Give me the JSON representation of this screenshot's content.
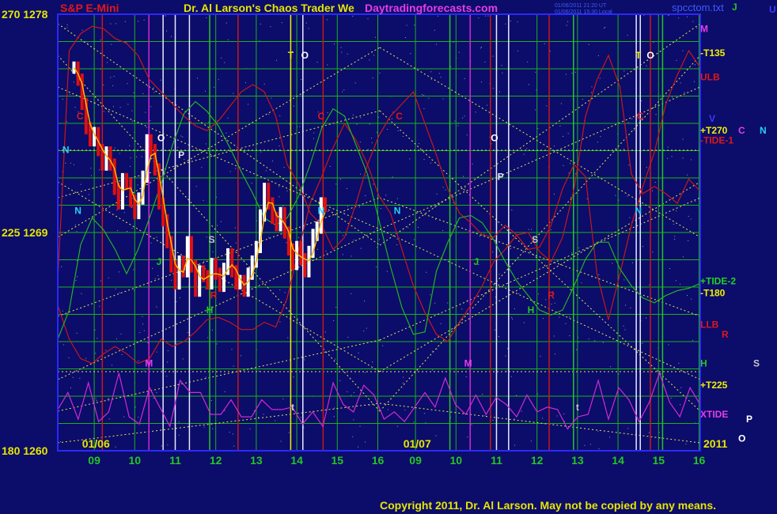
{
  "header": {
    "symbol": "S&P E-Mini",
    "title": "Dr. Al Larson's Chaos Trader We",
    "site": "Daytradingforecasts.com",
    "stamp1": "01/06/2011 21:20 UT",
    "stamp2": "01/06/2011 15:30 Local",
    "file": "spcctom.txt"
  },
  "footer": {
    "copyright": "Copyright 2011, Dr. Al Larson. May not be copied by any means.",
    "year": "2011"
  },
  "colors": {
    "background": "#0c0c6a",
    "frame": "#2a2aff",
    "grid": "#18b418",
    "fan": "#e6e650",
    "tick_label": "#e6e600",
    "up_bar": "#ffffff",
    "down_bar": "#e01010",
    "moving_avg": "#ffb400",
    "red_line": "#c81818",
    "green_line": "#22b422",
    "xtide": "#d22ad2",
    "blue_line": "#3c3cff"
  },
  "chart_data": {
    "type": "line",
    "title": "S&P E-Mini",
    "xlabel": "",
    "ylabel": "",
    "ylim": [
      1260,
      1278
    ],
    "grid": true,
    "y_labels_left": [
      {
        "value": 1278,
        "text": "270  1278"
      },
      {
        "value": 1269,
        "text": "225  1269"
      },
      {
        "value": 1260,
        "text": "180  1260"
      }
    ],
    "x_ticks": [
      {
        "day": 1,
        "hour": 9,
        "label": "09"
      },
      {
        "day": 1,
        "hour": 10,
        "label": "10"
      },
      {
        "day": 1,
        "hour": 11,
        "label": "11"
      },
      {
        "day": 1,
        "hour": 12,
        "label": "12"
      },
      {
        "day": 1,
        "hour": 13,
        "label": "13"
      },
      {
        "day": 1,
        "hour": 14,
        "label": "14"
      },
      {
        "day": 1,
        "hour": 15,
        "label": "15"
      },
      {
        "day": 1,
        "hour": 16,
        "label": "16"
      },
      {
        "day": 2,
        "hour": 9,
        "label": "09"
      },
      {
        "day": 2,
        "hour": 10,
        "label": "10"
      },
      {
        "day": 2,
        "hour": 11,
        "label": "11"
      },
      {
        "day": 2,
        "hour": 12,
        "label": "12"
      },
      {
        "day": 2,
        "hour": 13,
        "label": "13"
      },
      {
        "day": 2,
        "hour": 14,
        "label": "14"
      },
      {
        "day": 2,
        "hour": 15,
        "label": "15"
      },
      {
        "day": 2,
        "hour": 16,
        "label": "16"
      }
    ],
    "date_labels": [
      {
        "day": 1,
        "hour": 8.7,
        "label": "01/06"
      },
      {
        "day": 2,
        "hour": 8.7,
        "label": "01/07"
      }
    ],
    "price_bars": {
      "interval_hours": 0.1,
      "start_hour": 8.5,
      "values": [
        1275.8,
        1275.3,
        1274.3,
        1273.3,
        1272.8,
        1273.1,
        1272.4,
        1271.8,
        1272.3,
        1271.8,
        1270.8,
        1270.2,
        1271.2,
        1271.0,
        1270.3,
        1269.8,
        1270.4,
        1271.3,
        1272.8,
        1272.4,
        1271.6,
        1270.2,
        1269.5,
        1268.6,
        1267.6,
        1266.9,
        1267.8,
        1267.4,
        1268.6,
        1267.6,
        1266.6,
        1267.4,
        1267.2,
        1266.9,
        1267.7,
        1267.3,
        1266.8,
        1267.5,
        1268.1,
        1267.4,
        1266.9,
        1267.0,
        1266.6,
        1267.3,
        1267.8,
        1268.4,
        1269.7,
        1270.8,
        1270.2,
        1269.6,
        1269.3,
        1269.8,
        1269.0,
        1268.3,
        1267.7,
        1268.4,
        1267.9,
        1267.4,
        1268.2,
        1268.9,
        1269.2,
        1270.2,
        1270.1
      ]
    },
    "series": [
      {
        "name": "ULB",
        "label_value": 1275.4,
        "values": [
          1267.0,
          1276.5,
          1277.2,
          1277.5,
          1277.4,
          1277.0,
          1276.8,
          1276.3,
          1275.3,
          1274.8,
          1274.3,
          1273.8,
          1273.4,
          1273.2,
          1273.6,
          1274.2,
          1274.8,
          1275.1,
          1274.8,
          1273.8,
          1271.8,
          1271.0,
          1269.8,
          1269.3,
          1268.3,
          1268.8,
          1270.2,
          1271.8,
          1273.0,
          1273.8,
          1274.3,
          1274.8,
          1273.5,
          1272.2,
          1270.8,
          1269.8,
          1269.4,
          1268.9,
          1268.8,
          1269.3,
          1268.9,
          1269.0,
          1268.2,
          1267.8,
          1268.8,
          1270.8,
          1273.8,
          1275.3,
          1276.3,
          1275.0,
          1271.4,
          1270.6,
          1270.9,
          1270.6,
          1270.2,
          1271.2,
          1270.7
        ]
      },
      {
        "name": "LLB",
        "label_value": 1265.2,
        "values": [
          1266.0,
          1264.6,
          1263.8,
          1263.6,
          1264.0,
          1264.3,
          1264.0,
          1263.6,
          1263.8,
          1264.6,
          1264.3,
          1264.5,
          1264.9,
          1265.4,
          1265.5,
          1265.3,
          1265.0,
          1265.0,
          1265.3,
          1265.1,
          1266.3,
          1268.3,
          1270.2,
          1271.3,
          1272.5,
          1273.5,
          1272.8,
          1271.8,
          1270.5,
          1269.8,
          1268.3,
          1266.8,
          1265.7,
          1264.8,
          1264.5,
          1265.3,
          1266.0,
          1266.8,
          1267.8,
          1268.3,
          1268.9,
          1268.3,
          1268.4,
          1269.3,
          1270.8,
          1271.8,
          1271.3,
          1267.3,
          1265.4,
          1267.3,
          1269.3,
          1270.9,
          1272.3,
          1274.3,
          1275.5,
          1276.5,
          1275.8
        ]
      },
      {
        "name": "+TIDE-2",
        "label_value": 1267.0,
        "values": [
          1264.6,
          1265.8,
          1268.5,
          1269.6,
          1269.1,
          1268.3,
          1267.3,
          1268.3,
          1269.6,
          1271.0,
          1272.6,
          1273.9,
          1274.4,
          1274.0,
          1273.4,
          1272.5,
          1271.5,
          1270.6,
          1269.6,
          1269.3,
          1269.6,
          1270.5,
          1271.8,
          1273.3,
          1274.1,
          1273.8,
          1272.6,
          1271.4,
          1269.5,
          1267.6,
          1265.9,
          1264.8,
          1264.9,
          1267.4,
          1268.6,
          1269.6,
          1269.7,
          1269.4,
          1268.7,
          1267.8,
          1267.0,
          1266.4,
          1265.8,
          1265.6,
          1265.8,
          1266.8,
          1267.9,
          1268.6,
          1268.6,
          1267.5,
          1266.8,
          1266.3,
          1266.1,
          1266.4,
          1266.6,
          1266.7,
          1266.9
        ]
      },
      {
        "name": "XTIDE",
        "label_value": 1261.5,
        "values": [
          1261.7,
          1262.4,
          1261.3,
          1262.8,
          1261.2,
          1261.6,
          1263.2,
          1261.4,
          1261.1,
          1262.6,
          1261.8,
          1261.0,
          1262.9,
          1262.4,
          1262.4,
          1261.5,
          1261.5,
          1262.1,
          1261.4,
          1261.4,
          1262.1,
          1261.7,
          1261.7,
          1261.8,
          1261.1,
          1261.6,
          1261.0,
          1262.8,
          1261.9,
          1261.6,
          1262.7,
          1262.3,
          1261.3,
          1261.6,
          1261.2,
          1261.8,
          1262.4,
          1261.8,
          1263.0,
          1261.9,
          1261.5,
          1262.3,
          1261.5,
          1262.2,
          1261.9,
          1261.4,
          1262.3,
          1261.6,
          1261.8,
          1261.7,
          1260.9,
          1261.4,
          1261.5,
          1262.9,
          1261.3,
          1262.6,
          1262.1,
          1261.2,
          1262.0,
          1263.2,
          1262.0,
          1261.4,
          1262.6,
          1261.9
        ]
      }
    ],
    "right_labels": [
      {
        "text": "M",
        "value": 1277.4
      },
      {
        "text": "-T135",
        "value": 1276.4
      },
      {
        "text": "+T270",
        "value": 1273.2
      },
      {
        "text": "-TIDE-1",
        "value": 1272.8
      },
      {
        "text": "-T180",
        "value": 1266.5
      },
      {
        "text": "H",
        "value": 1263.6
      },
      {
        "text": "+T225",
        "value": 1262.7
      },
      {
        "text": "2011",
        "value": 1260.0
      }
    ],
    "right_column_letters": [
      {
        "text": "J",
        "value": 1278.3
      },
      {
        "text": "U",
        "value": 1278.2
      },
      {
        "text": "V",
        "value": 1273.7
      },
      {
        "text": "C",
        "value": 1273.2
      },
      {
        "text": "N",
        "value": 1273.2
      },
      {
        "text": "R",
        "value": 1264.8
      },
      {
        "text": "S",
        "value": 1263.6
      },
      {
        "text": "P",
        "value": 1261.3
      },
      {
        "text": "O",
        "value": 1260.5
      }
    ],
    "annotations": [
      {
        "day": 1,
        "hour": 8.65,
        "value": 1273.8,
        "text": "C"
      },
      {
        "day": 1,
        "hour": 8.6,
        "value": 1269.9,
        "text": "N"
      },
      {
        "day": 1,
        "hour": 8.3,
        "value": 1272.4,
        "text": "N"
      },
      {
        "day": 1,
        "hour": 10.35,
        "value": 1263.6,
        "text": "M"
      },
      {
        "day": 1,
        "hour": 10.65,
        "value": 1272.9,
        "text": "O"
      },
      {
        "day": 1,
        "hour": 11.15,
        "value": 1272.2,
        "text": "P"
      },
      {
        "day": 1,
        "hour": 10.6,
        "value": 1267.8,
        "text": "J"
      },
      {
        "day": 1,
        "hour": 11.95,
        "value": 1266.4,
        "text": "R"
      },
      {
        "day": 1,
        "hour": 11.9,
        "value": 1268.7,
        "text": "S"
      },
      {
        "day": 1,
        "hour": 11.85,
        "value": 1265.8,
        "text": "H"
      },
      {
        "day": 1,
        "hour": 13.85,
        "value": 1276.3,
        "text": "T"
      },
      {
        "day": 1,
        "hour": 14.2,
        "value": 1276.3,
        "text": "O"
      },
      {
        "day": 1,
        "hour": 14.6,
        "value": 1273.8,
        "text": "C"
      },
      {
        "day": 1,
        "hour": 14.6,
        "value": 1269.9,
        "text": "N"
      },
      {
        "day": 2,
        "hour": 8.6,
        "value": 1273.8,
        "text": "C"
      },
      {
        "day": 2,
        "hour": 8.55,
        "value": 1269.9,
        "text": "N"
      },
      {
        "day": 2,
        "hour": 10.3,
        "value": 1263.6,
        "text": "M"
      },
      {
        "day": 2,
        "hour": 10.95,
        "value": 1272.9,
        "text": "O"
      },
      {
        "day": 2,
        "hour": 11.1,
        "value": 1271.3,
        "text": "P"
      },
      {
        "day": 2,
        "hour": 10.5,
        "value": 1267.8,
        "text": "J"
      },
      {
        "day": 2,
        "hour": 12.35,
        "value": 1266.4,
        "text": "R"
      },
      {
        "day": 2,
        "hour": 11.95,
        "value": 1268.7,
        "text": "S"
      },
      {
        "day": 2,
        "hour": 11.85,
        "value": 1265.8,
        "text": "H"
      },
      {
        "day": 2,
        "hour": 14.5,
        "value": 1276.3,
        "text": "T"
      },
      {
        "day": 2,
        "hour": 14.8,
        "value": 1276.3,
        "text": "O"
      },
      {
        "day": 2,
        "hour": 14.55,
        "value": 1273.8,
        "text": "C"
      },
      {
        "day": 2,
        "hour": 14.5,
        "value": 1269.9,
        "text": "N"
      },
      {
        "day": 1,
        "hour": 13.9,
        "value": 1261.8,
        "text": "t"
      },
      {
        "day": 2,
        "hour": 13.0,
        "value": 1261.8,
        "text": "t"
      }
    ],
    "vertical_lines": [
      {
        "day": 1,
        "hour": 10.7,
        "color": "white"
      },
      {
        "day": 1,
        "hour": 11.0,
        "color": "white"
      },
      {
        "day": 1,
        "hour": 11.35,
        "color": "white"
      },
      {
        "day": 1,
        "hour": 13.85,
        "color": "yellow"
      },
      {
        "day": 1,
        "hour": 14.15,
        "color": "white"
      },
      {
        "day": 1,
        "hour": 11.85,
        "color": "green"
      },
      {
        "day": 1,
        "hour": 12.55,
        "color": "red"
      },
      {
        "day": 1,
        "hour": 14.65,
        "color": "red"
      },
      {
        "day": 1,
        "hour": 9.2,
        "color": "red"
      },
      {
        "day": 1,
        "hour": 10.35,
        "color": "magenta"
      },
      {
        "day": 2,
        "hour": 11.0,
        "color": "white"
      },
      {
        "day": 2,
        "hour": 11.3,
        "color": "white"
      },
      {
        "day": 2,
        "hour": 10.35,
        "color": "magenta"
      },
      {
        "day": 2,
        "hour": 14.45,
        "color": "white"
      },
      {
        "day": 2,
        "hour": 14.55,
        "color": "white"
      },
      {
        "day": 2,
        "hour": 12.3,
        "color": "red"
      },
      {
        "day": 2,
        "hour": 14.8,
        "color": "red"
      },
      {
        "day": 2,
        "hour": 10.85,
        "color": "red"
      },
      {
        "day": 2,
        "hour": 9.85,
        "color": "green"
      },
      {
        "day": 2,
        "hour": 12.9,
        "color": "green"
      },
      {
        "day": 2,
        "hour": 15.1,
        "color": "green"
      }
    ]
  }
}
